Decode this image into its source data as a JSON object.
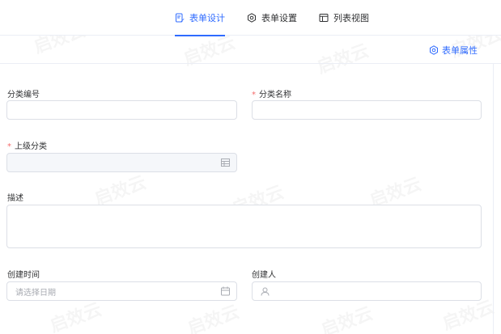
{
  "tabs": [
    {
      "label": "表单设计",
      "icon": "form-edit-icon",
      "active": true
    },
    {
      "label": "表单设置",
      "icon": "gear-icon",
      "active": false
    },
    {
      "label": "列表视图",
      "icon": "table-icon",
      "active": false
    }
  ],
  "toolbar": {
    "form_properties_label": "表单属性",
    "icon": "gear-icon"
  },
  "fields": {
    "category_code": {
      "label": "分类编号",
      "required": false,
      "value": ""
    },
    "category_name": {
      "label": "分类名称",
      "required": true,
      "value": ""
    },
    "parent_category": {
      "label": "上级分类",
      "required": true,
      "value": "",
      "suffix_icon": "table-select-icon"
    },
    "description": {
      "label": "描述",
      "required": false,
      "value": ""
    },
    "created_time": {
      "label": "创建时间",
      "required": false,
      "placeholder": "请选择日期",
      "suffix_icon": "calendar-icon"
    },
    "creator": {
      "label": "创建人",
      "required": false,
      "value": "",
      "prefix_icon": "user-icon"
    }
  },
  "required_mark": "*",
  "watermark_text": "启效云",
  "colors": {
    "accent": "#2f6bff",
    "required": "#f56c6c",
    "border": "#dcdfe6"
  }
}
